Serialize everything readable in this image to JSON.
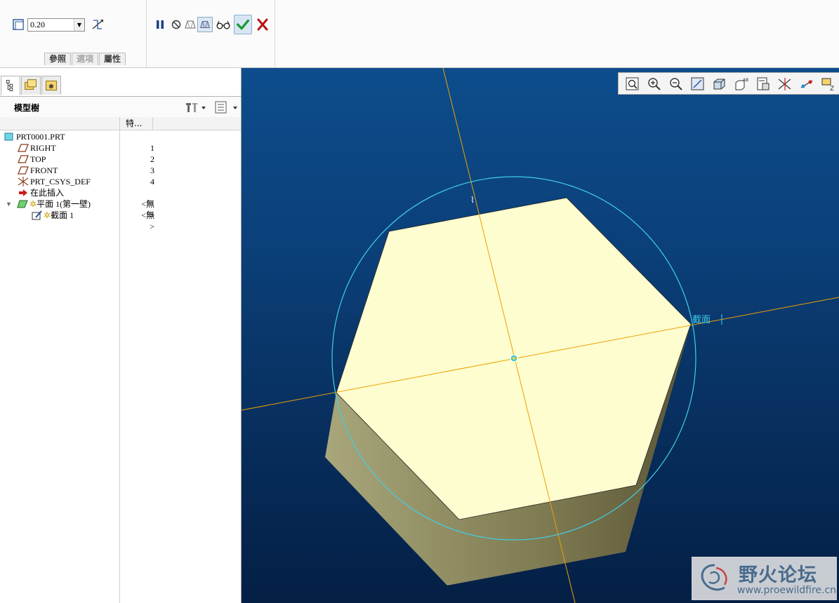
{
  "dashboard": {
    "thickness_value": "0.20",
    "tabs": [
      {
        "label": "參照",
        "enabled": true
      },
      {
        "label": "選項",
        "enabled": false
      },
      {
        "label": "屬性",
        "enabled": true
      }
    ]
  },
  "model_tree": {
    "title": "模型樹",
    "columns": {
      "name": "",
      "feature": "特..."
    },
    "rows": [
      {
        "label": "PRT0001.PRT",
        "num": ""
      },
      {
        "label": "RIGHT",
        "num": "1"
      },
      {
        "label": "TOP",
        "num": "2"
      },
      {
        "label": "FRONT",
        "num": "3"
      },
      {
        "label": "PRT_CSYS_DEF",
        "num": "4"
      },
      {
        "label": "在此插入",
        "num": ""
      },
      {
        "label": "平面 1(第一壁)",
        "num": "<無>"
      },
      {
        "label": "截面 1",
        "num": "<無>"
      }
    ]
  },
  "graphics": {
    "section_label": "截面"
  },
  "watermark": {
    "title": "野火论坛",
    "url": "www.proewildfire.cn"
  },
  "colors": {
    "accent_green": "#1c9b2e",
    "cancel_red": "#b81414",
    "datum_orange": "#f0a000",
    "sketch_cyan": "#40d0e8",
    "face_top": "#fdfdcf",
    "face_side": "#8e8a5e"
  }
}
